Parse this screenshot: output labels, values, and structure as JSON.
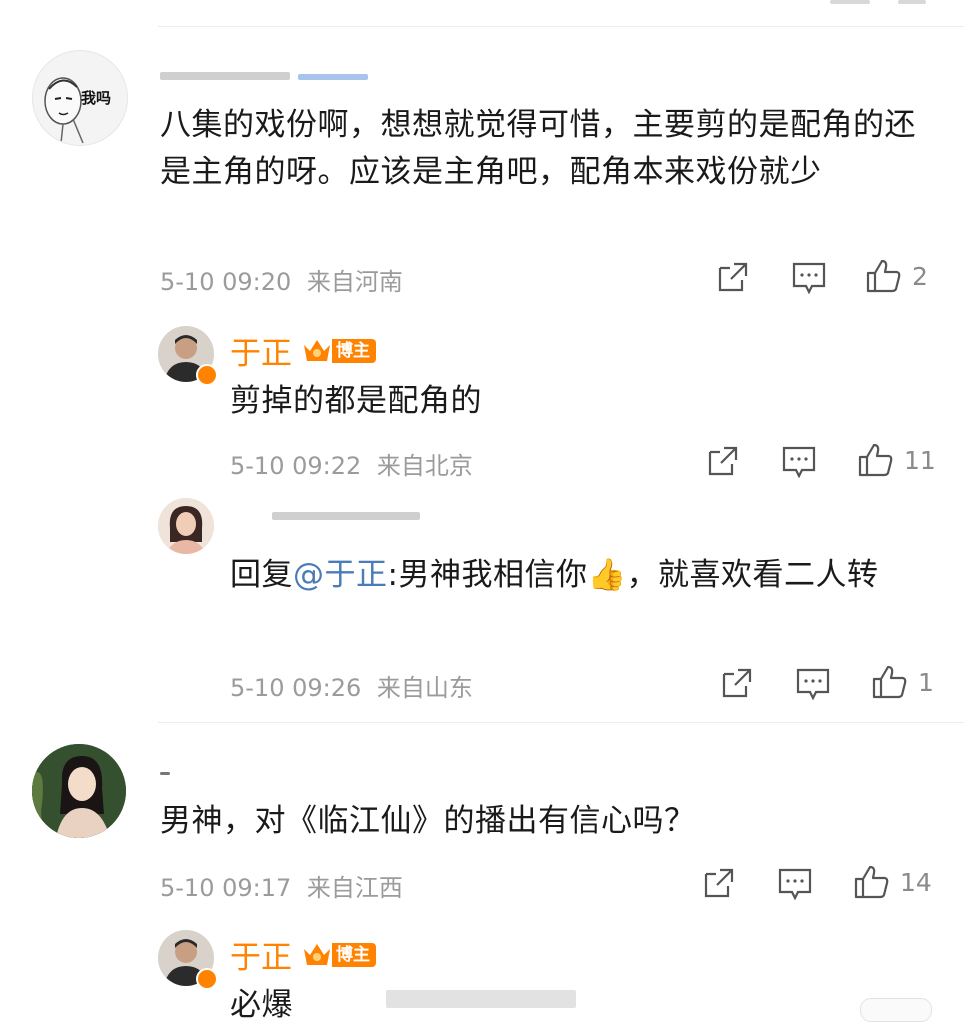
{
  "comments": [
    {
      "text": "八集的戏份啊，想想就觉得可惜，主要剪的是配角的还是主角的呀。应该是主角吧，配角本来戏份就少",
      "avatar_text": "我吗",
      "time": "5-10 09:20",
      "location": "来自河南",
      "likes": "2"
    },
    {
      "text": "男神，对《临江仙》的播出有信心吗？",
      "time": "5-10 09:17",
      "location": "来自江西",
      "likes": "14"
    }
  ],
  "replies": [
    {
      "author": "于正",
      "badge": "博主",
      "text": "剪掉的都是配角的",
      "time": "5-10 09:22",
      "location": "来自北京",
      "likes": "11"
    },
    {
      "prefix": "回复",
      "mention": "@于正",
      "text_before_emoji": ":男神我相信你",
      "text_after_emoji": "，就喜欢看二人转",
      "emoji": "👍",
      "time": "5-10 09:26",
      "location": "来自山东",
      "likes": "1"
    },
    {
      "author": "于正",
      "badge": "博主",
      "text": "必爆"
    }
  ],
  "icons": {
    "share": "share-icon",
    "comment": "comment-icon",
    "like": "like-icon",
    "vip": "crown-icon"
  },
  "colors": {
    "author": "#ff8200",
    "mention": "#4a7cb8",
    "meta": "#9b9b9b"
  }
}
